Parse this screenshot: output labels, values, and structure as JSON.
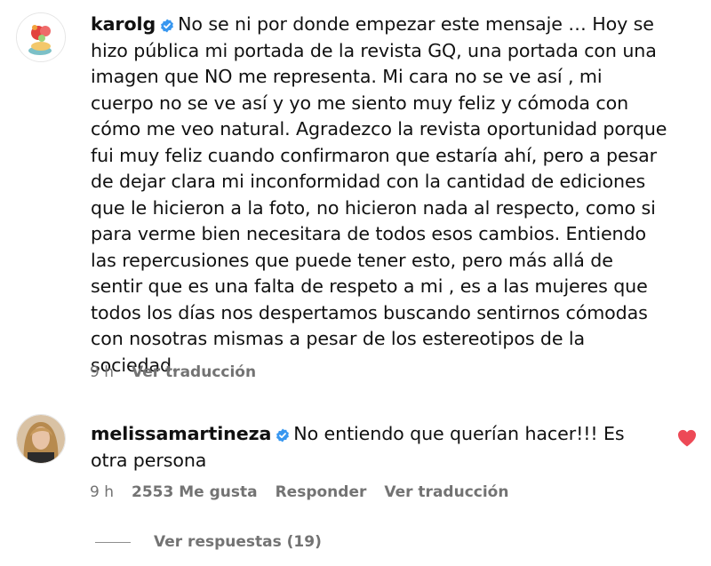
{
  "comments": [
    {
      "username": "karolg",
      "text": "No se ni por donde empezar este mensaje … Hoy se hizo pública mi portada de la revista GQ, una portada con una imagen que NO me representa. Mi cara no se ve así , mi cuerpo no se ve así y yo me siento muy feliz y cómoda con cómo me veo natural. Agradezco la revista oportunidad porque fui muy feliz cuando confirmaron que estaría ahí, pero a pesar de dejar clara mi inconformidad con la cantidad de ediciones que le hicieron a la foto, no hicieron nada al respecto, como si para verme bien necesitara de todos esos cambios. Entiendo las repercusiones que puede tener esto, pero más allá de sentir que es una falta de respeto a mi , es a las mujeres que todos los días nos despertamos buscando sentirnos cómodas con nosotras mismas a pesar de los estereotipos de la sociedad.",
      "time": "9 h",
      "translate": "Ver traducción"
    },
    {
      "username": "melissamartineza",
      "text": "No entiendo que querían hacer!!! Es otra persona",
      "time": "9 h",
      "likes": "2553 Me gusta",
      "reply": "Responder",
      "translate": "Ver traducción"
    }
  ],
  "view_replies": "Ver respuestas (19)",
  "colors": {
    "verified": "#3897f0",
    "heart": "#ed4956",
    "meta": "#737373"
  }
}
